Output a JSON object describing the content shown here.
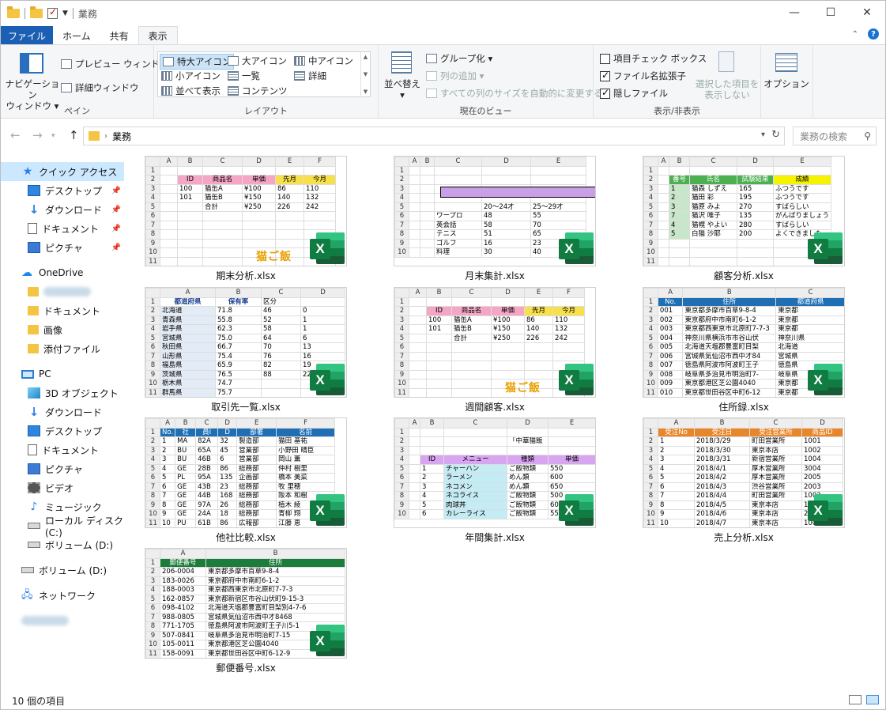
{
  "window": {
    "title": "業務"
  },
  "tabs": [
    {
      "label": "ファイル"
    },
    {
      "label": "ホーム"
    },
    {
      "label": "共有"
    },
    {
      "label": "表示"
    }
  ],
  "ribbon": {
    "pane": {
      "navigation_pane": "ナビゲーション\nウィンドウ ▾",
      "preview": "プレビュー ウィンドウ",
      "details": "詳細ウィンドウ",
      "label": "ペイン"
    },
    "layout": {
      "items": [
        "特大アイコン",
        "大アイコン",
        "中アイコン",
        "小アイコン",
        "一覧",
        "詳細",
        "並べて表示",
        "コンテンツ"
      ],
      "label": "レイアウト"
    },
    "current_view": {
      "sort": "並べ替え",
      "group_by": "グループ化 ▾",
      "add_columns": "列の追加 ▾",
      "size_columns": "すべての列のサイズを自動的に変更する",
      "label": "現在のビュー"
    },
    "show_hide": {
      "item_checkboxes": "項目チェック ボックス",
      "file_extensions": "ファイル名拡張子",
      "hidden_items": "隠しファイル",
      "hide_selected": "選択した項目を\n表示しない",
      "label": "表示/非表示"
    },
    "options": "オプション"
  },
  "address": {
    "path": "業務",
    "search_placeholder": "業務の検索"
  },
  "nav": {
    "quick_access": "クイック アクセス",
    "qa_items": [
      "デスクトップ",
      "ダウンロード",
      "ドキュメント",
      "ピクチャ"
    ],
    "onedrive": "OneDrive",
    "onedrive_items": [
      "ドキュメント",
      "画像",
      "添付ファイル"
    ],
    "pc": "PC",
    "pc_items": [
      "3D オブジェクト",
      "ダウンロード",
      "デスクトップ",
      "ドキュメント",
      "ピクチャ",
      "ビデオ",
      "ミュージック",
      "ローカル ディスク (C:)",
      "ボリューム (D:)"
    ],
    "volume": "ボリューム (D:)",
    "network": "ネットワーク"
  },
  "files": [
    {
      "name": "期末分析.xlsx"
    },
    {
      "name": "月末集計.xlsx"
    },
    {
      "name": "顧客分析.xlsx"
    },
    {
      "name": "取引先一覧.xlsx"
    },
    {
      "name": "週間顧客.xlsx"
    },
    {
      "name": "住所録.xlsx"
    },
    {
      "name": "他社比較.xlsx"
    },
    {
      "name": "年間集計.xlsx"
    },
    {
      "name": "売上分析.xlsx"
    },
    {
      "name": "郵便番号.xlsx"
    }
  ],
  "thumbs": {
    "t1": {
      "cols": [
        "",
        "A",
        "B",
        "C",
        "D",
        "E",
        "F"
      ],
      "rows": [
        [
          "1",
          "",
          "",
          "",
          "",
          "",
          ""
        ],
        [
          "2",
          "",
          "ID",
          "商品名",
          "単価",
          "先月",
          "今月"
        ],
        [
          "3",
          "",
          "100",
          "猫缶A",
          "¥100",
          "86",
          "110"
        ],
        [
          "4",
          "",
          "101",
          "猫缶B",
          "¥150",
          "140",
          "132"
        ],
        [
          "5",
          "",
          "",
          "合計",
          "¥250",
          "226",
          "242"
        ],
        [
          "6",
          "",
          "",
          "",
          "",
          "",
          ""
        ],
        [
          "7",
          "",
          "",
          "",
          "",
          "",
          ""
        ],
        [
          "8",
          "",
          "",
          "",
          "",
          "",
          ""
        ],
        [
          "9",
          "",
          "",
          "",
          "",
          "",
          ""
        ],
        [
          "10",
          "",
          "",
          "",
          "",
          "",
          ""
        ],
        [
          "11",
          "",
          "",
          "",
          "",
          "",
          ""
        ]
      ],
      "banner": "猫ご飯"
    },
    "t2": {
      "cols": [
        "",
        "A",
        "B",
        "C",
        "D",
        "E"
      ],
      "rows": [
        [
          "1",
          "",
          "",
          "",
          "",
          ""
        ],
        [
          "2",
          "",
          "",
          "",
          "",
          ""
        ],
        [
          "3",
          "",
          "",
          "",
          "",
          ""
        ],
        [
          "4",
          "",
          "",
          "",
          "",
          ""
        ],
        [
          "5",
          "",
          "",
          "",
          "20～24才",
          "25～29才"
        ],
        [
          "6",
          "",
          "",
          "ワープロ",
          "48",
          "55"
        ],
        [
          "7",
          "",
          "",
          "英会話",
          "58",
          "70"
        ],
        [
          "8",
          "",
          "",
          "テニス",
          "51",
          "65"
        ],
        [
          "9",
          "",
          "",
          "ゴルフ",
          "16",
          "23"
        ],
        [
          "10",
          "",
          "",
          "料理",
          "30",
          "40"
        ]
      ]
    },
    "t3": {
      "cols": [
        "",
        "A",
        "B",
        "C",
        "D",
        "E"
      ],
      "rows": [
        [
          "1",
          "",
          "",
          "",
          "",
          ""
        ],
        [
          "2",
          "",
          "番号",
          "氏名",
          "試験結果",
          "成績"
        ],
        [
          "3",
          "",
          "1",
          "猫森 しずえ",
          "165",
          "ふつうです"
        ],
        [
          "4",
          "",
          "2",
          "猫田 彩",
          "195",
          "ふつうです"
        ],
        [
          "5",
          "",
          "3",
          "猫原 みよ",
          "270",
          "すばらしい"
        ],
        [
          "6",
          "",
          "7",
          "猫沢 唯子",
          "135",
          "がんばりましょう"
        ],
        [
          "7",
          "",
          "4",
          "猫幌 やよい",
          "280",
          "すばらしい"
        ],
        [
          "8",
          "",
          "5",
          "白猫 沙耶",
          "200",
          "よくできました"
        ],
        [
          "9",
          "",
          "",
          "",
          "",
          ""
        ],
        [
          "10",
          "",
          "",
          "",
          "",
          ""
        ],
        [
          "11",
          "",
          "",
          "",
          "",
          ""
        ]
      ]
    },
    "t4": {
      "cols": [
        "",
        "A",
        "B",
        "C",
        "D"
      ],
      "rows": [
        [
          "1",
          "都道府県",
          "保有率",
          "区分",
          ""
        ],
        [
          "2",
          "北海道",
          "71.8",
          "46",
          "0"
        ],
        [
          "3",
          "青森県",
          "55.8",
          "52",
          "1"
        ],
        [
          "4",
          "岩手県",
          "62.3",
          "58",
          "1"
        ],
        [
          "5",
          "宮城県",
          "75.0",
          "64",
          "6"
        ],
        [
          "6",
          "秋田県",
          "66.7",
          "70",
          "13"
        ],
        [
          "7",
          "山形県",
          "75.4",
          "76",
          "16"
        ],
        [
          "8",
          "福島県",
          "65.9",
          "82",
          "19"
        ],
        [
          "9",
          "茨城県",
          "76.5",
          "88",
          "22"
        ],
        [
          "10",
          "栃木県",
          "74.7",
          "",
          ""
        ],
        [
          "11",
          "群馬県",
          "75.7",
          "",
          ""
        ]
      ]
    },
    "t5": {
      "cols": [
        "",
        "A",
        "B",
        "C",
        "D",
        "E",
        "F"
      ],
      "rows": [
        [
          "1",
          "",
          "",
          "",
          "",
          "",
          ""
        ],
        [
          "2",
          "",
          "ID",
          "商品名",
          "単価",
          "先月",
          "今月"
        ],
        [
          "3",
          "",
          "100",
          "猫缶A",
          "¥100",
          "86",
          "110"
        ],
        [
          "4",
          "",
          "101",
          "猫缶B",
          "¥150",
          "140",
          "132"
        ],
        [
          "5",
          "",
          "",
          "合計",
          "¥250",
          "226",
          "242"
        ],
        [
          "6",
          "",
          "",
          "",
          "",
          "",
          ""
        ],
        [
          "7",
          "",
          "",
          "",
          "",
          "",
          ""
        ],
        [
          "8",
          "",
          "",
          "",
          "",
          "",
          ""
        ],
        [
          "9",
          "",
          "",
          "",
          "",
          "",
          ""
        ],
        [
          "10",
          "",
          "",
          "",
          "",
          "",
          ""
        ],
        [
          "11",
          "",
          "",
          "",
          "",
          "",
          ""
        ]
      ],
      "banner": "猫ご飯"
    },
    "t6": {
      "cols": [
        "",
        "A",
        "B",
        "C"
      ],
      "rows": [
        [
          "1",
          "No.",
          "住所",
          "都道府県"
        ],
        [
          "2",
          "001",
          "東京都多摩市百草9-8-4",
          "東京都"
        ],
        [
          "3",
          "002",
          "東京都府中市南町6-1-2",
          "東京都"
        ],
        [
          "4",
          "003",
          "東京都西東京市北原町7-7-3",
          "東京都"
        ],
        [
          "5",
          "004",
          "神奈川県横浜市市谷山伏",
          "神奈川県"
        ],
        [
          "6",
          "005",
          "北海道天塩郡豊富町目梨",
          "北海道"
        ],
        [
          "7",
          "006",
          "宮城県気仙沼市西中才84",
          "宮城県"
        ],
        [
          "8",
          "007",
          "徳島県阿波市阿波町王子",
          "徳島県"
        ],
        [
          "9",
          "008",
          "岐阜県多治見市明治町7-",
          "岐阜県"
        ],
        [
          "10",
          "009",
          "東京都港区芝公園4040",
          "東京都"
        ],
        [
          "11",
          "010",
          "東京都世田谷区中町6-12",
          "東京都"
        ]
      ]
    },
    "t7": {
      "cols": [
        "",
        "A",
        "B",
        "C",
        "D",
        "E",
        "F"
      ],
      "rows": [
        [
          "1",
          "No.",
          "社",
          "員I",
          "D",
          "部署",
          "名前"
        ],
        [
          "2",
          "1",
          "MA",
          "82A",
          "32",
          "製造部",
          "猫田 基祐"
        ],
        [
          "3",
          "2",
          "BU",
          "65A",
          "45",
          "営業部",
          "小野田 晴臣"
        ],
        [
          "4",
          "3",
          "BU",
          "46B",
          "6",
          "営業部",
          "岡山 薫"
        ],
        [
          "5",
          "4",
          "GE",
          "28B",
          "86",
          "総務部",
          "仲村 樹里"
        ],
        [
          "6",
          "5",
          "PL",
          "95A",
          "135",
          "企画部",
          "橋本 美菜"
        ],
        [
          "7",
          "6",
          "GE",
          "43B",
          "23",
          "総務部",
          "牧 里穂"
        ],
        [
          "8",
          "7",
          "GE",
          "44B",
          "168",
          "総務部",
          "阪本 和樹"
        ],
        [
          "9",
          "8",
          "GE",
          "97A",
          "26",
          "総務部",
          "植木 綾"
        ],
        [
          "10",
          "9",
          "GE",
          "24A",
          "18",
          "総務部",
          "青柳 翔"
        ],
        [
          "11",
          "10",
          "PU",
          "61B",
          "86",
          "広報部",
          "江藤 恵"
        ]
      ]
    },
    "t8": {
      "cols": [
        "",
        "A",
        "B",
        "C",
        "D",
        "E"
      ],
      "rows": [
        [
          "1",
          "",
          "",
          "",
          "",
          ""
        ],
        [
          "2",
          "",
          "",
          "",
          "「中華猫飯",
          ""
        ],
        [
          "3",
          "",
          "",
          "",
          "",
          ""
        ],
        [
          "4",
          "",
          "ID",
          "メニュー",
          "種類",
          "単価"
        ],
        [
          "5",
          "",
          "1",
          "チャーハン",
          "ご飯物類",
          "550"
        ],
        [
          "6",
          "",
          "2",
          "ラーメン",
          "めん類",
          "600"
        ],
        [
          "7",
          "",
          "3",
          "ネコメン",
          "めん類",
          "650"
        ],
        [
          "8",
          "",
          "4",
          "ネコライス",
          "ご飯物類",
          "500"
        ],
        [
          "9",
          "",
          "5",
          "肉球丼",
          "ご飯物類",
          "600"
        ],
        [
          "10",
          "",
          "6",
          "カレーライス",
          "ご飯物類",
          "550"
        ]
      ]
    },
    "t9": {
      "cols": [
        "",
        "A",
        "B",
        "C",
        "D"
      ],
      "rows": [
        [
          "1",
          "受注No",
          "受注日",
          "受注営業所",
          "商品ID"
        ],
        [
          "2",
          "1",
          "2018/3/29",
          "町田営業所",
          "1001"
        ],
        [
          "3",
          "2",
          "2018/3/30",
          "東京本店",
          "1002"
        ],
        [
          "4",
          "3",
          "2018/3/31",
          "新宿営業所",
          "1004"
        ],
        [
          "5",
          "4",
          "2018/4/1",
          "厚木営業所",
          "3004"
        ],
        [
          "6",
          "5",
          "2018/4/2",
          "厚木営業所",
          "2005"
        ],
        [
          "7",
          "6",
          "2018/4/3",
          "渋谷営業所",
          "2003"
        ],
        [
          "8",
          "7",
          "2018/4/4",
          "町田営業所",
          "1002"
        ],
        [
          "9",
          "8",
          "2018/4/5",
          "東京本店",
          "1003"
        ],
        [
          "10",
          "9",
          "2018/4/6",
          "東京本店",
          "2004"
        ],
        [
          "11",
          "10",
          "2018/4/7",
          "東京本店",
          "1001"
        ]
      ]
    },
    "t10": {
      "cols": [
        "",
        "A",
        "B"
      ],
      "rows": [
        [
          "1",
          "郵便番号",
          "住所"
        ],
        [
          "2",
          "206-0004",
          "東京都多摩市百草9-8-4"
        ],
        [
          "3",
          "183-0026",
          "東京都府中市南町6-1-2"
        ],
        [
          "4",
          "188-0003",
          "東京都西東京市北原町7-7-3"
        ],
        [
          "5",
          "162-0857",
          "東京都新宿区市谷山伏町9-15-3"
        ],
        [
          "6",
          "098-4102",
          "北海道天塩郡豊富町目梨別4-7-6"
        ],
        [
          "7",
          "988-0805",
          "宮城県気仙沼市西中才8468"
        ],
        [
          "8",
          "771-1705",
          "徳島県阿波市阿波町王子川5-1"
        ],
        [
          "9",
          "507-0841",
          "岐阜県多治見市明治町7-15"
        ],
        [
          "10",
          "105-0011",
          "東京都港区芝公園4040"
        ],
        [
          "11",
          "158-0091",
          "東京都世田谷区中町6-12-9"
        ]
      ]
    }
  },
  "status": {
    "count": "10 個の項目"
  }
}
